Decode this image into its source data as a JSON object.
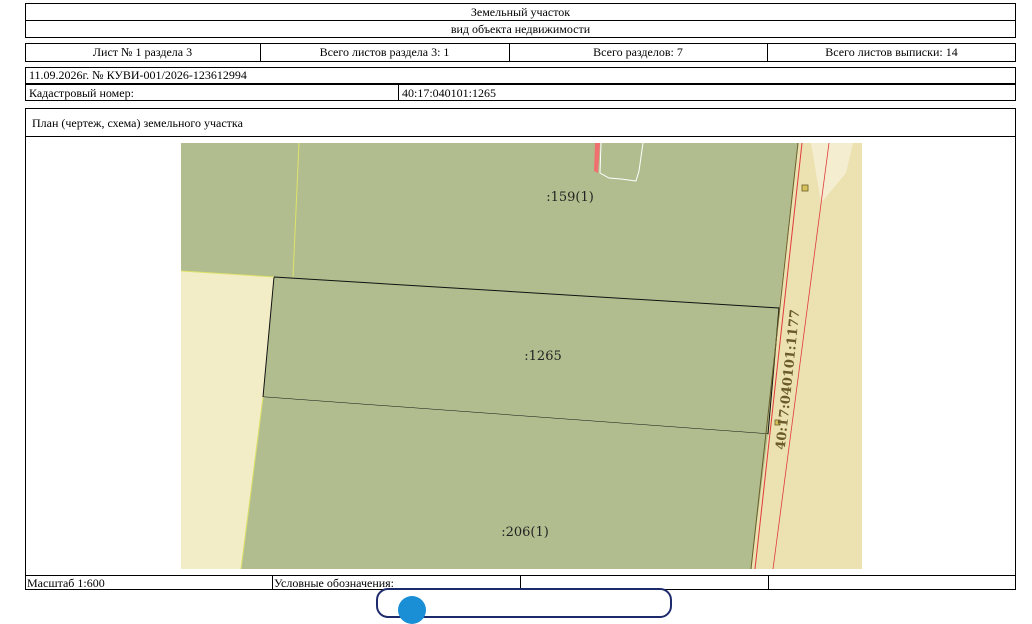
{
  "header": {
    "title": "Земельный участок",
    "subtitle": "вид объекта недвижимости"
  },
  "sheet_info": {
    "sheet": "Лист № 1 раздела 3",
    "total_sheets_section": "Всего листов раздела 3: 1",
    "total_sections": "Всего разделов: 7",
    "total_sheets_extract": "Всего листов выписки: 14"
  },
  "document_ref": "11.09.2026г. № КУВИ-001/2026-123612994",
  "cadastral": {
    "label": "Кадастровый номер:",
    "value": "40:17:040101:1265"
  },
  "plan": {
    "title": "План (чертеж, схема) земельного участка",
    "labels": {
      "parcel_north": ":159(1)",
      "parcel_main": ":1265",
      "parcel_south": ":206(1)",
      "road": "40:17:040101:1177"
    },
    "colors": {
      "parcel_fill": "#b1bd8e",
      "empty_fill": "#f2ecc7",
      "road_fill": "#ece1b0",
      "boundary_red": "#e03a3a",
      "marker_fill": "#d6c15a"
    }
  },
  "footer": {
    "scale": "Масштаб 1:600",
    "legend_label": "Условные обозначения:"
  }
}
